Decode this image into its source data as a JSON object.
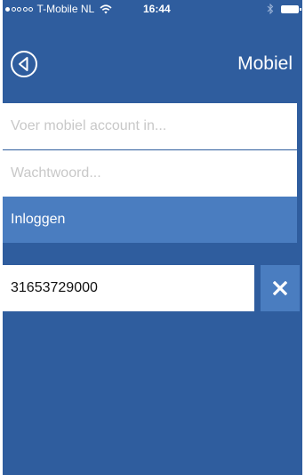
{
  "status_bar": {
    "signal_dots_filled": 1,
    "signal_dots_total": 5,
    "carrier": "T-Mobile NL",
    "time": "16:44",
    "wifi_icon": "wifi-icon",
    "bluetooth_icon": "bluetooth-icon",
    "battery_icon": "battery-icon"
  },
  "nav": {
    "back_icon": "back-circle-icon",
    "title": "Mobiel"
  },
  "form": {
    "account_placeholder": "Voer mobiel account in...",
    "password_placeholder": "Wachtwoord...",
    "login_label": "Inloggen"
  },
  "saved_account": {
    "number": "31653729000",
    "remove_icon": "close-icon"
  },
  "colors": {
    "background": "#2f5d9e",
    "button": "#4a7dc0",
    "field": "#ffffff",
    "placeholder": "#c8c8c8"
  }
}
